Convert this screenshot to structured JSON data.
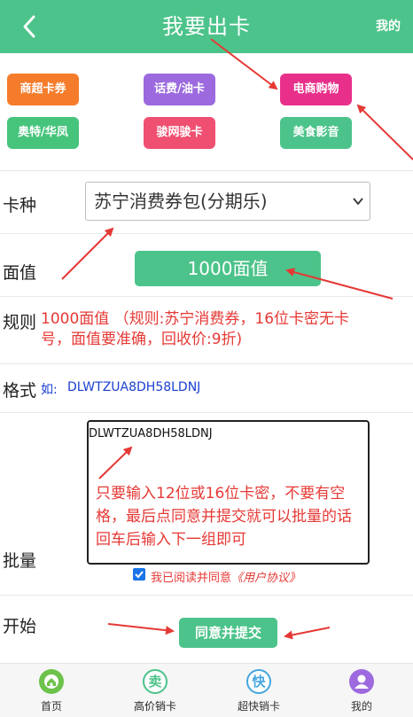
{
  "header": {
    "title": "我要出卡",
    "back_icon": "chevron-left-icon",
    "mine": "我的"
  },
  "categories": [
    {
      "label": "商超卡券",
      "color": "#f57c2b"
    },
    {
      "label": "话费/油卡",
      "color": "#9c6ade"
    },
    {
      "label": "电商购物",
      "color": "#e8308a"
    },
    {
      "label": "奥特/华凤",
      "color": "#47c47c"
    },
    {
      "label": "骏网骏卡",
      "color": "#ef4f70"
    },
    {
      "label": "美食影音",
      "color": "#4cc38a"
    }
  ],
  "form": {
    "card_type_label": "卡种",
    "card_type_value": "苏宁消费券包(分期乐)",
    "face_label": "面值",
    "face_value": "1000面值",
    "rule_label": "规则",
    "rule_text": "1000面值 （规则:苏宁消费券，16位卡密无卡号，面值要准确，回收价:9折)",
    "format_label": "格式",
    "format_prefix": "如:",
    "format_code": "DLWTZUA8DH58LDNJ",
    "batch_label": "批量",
    "batch_value": "DLWTZUA8DH58LDNJ",
    "batch_note": "只要输入12位或16位卡密，不要有空格，最后点同意并提交就可以批量的话回车后输入下一组即可",
    "agree_prefix": "我已阅读并同意",
    "agree_link": "《用户协议》",
    "start_label": "开始",
    "submit_label": "同意并提交"
  },
  "tabbar": [
    {
      "label": "首页",
      "icon": "home-icon",
      "badge": "",
      "color": "#6cc24a"
    },
    {
      "label": "高价销卡",
      "icon": "sell-icon",
      "badge": "卖",
      "color": "#4cc38a"
    },
    {
      "label": "超快销卡",
      "icon": "fast-icon",
      "badge": "快",
      "color": "#45a6e0"
    },
    {
      "label": "我的",
      "icon": "user-icon",
      "badge": "",
      "color": "#9c6ade"
    }
  ]
}
